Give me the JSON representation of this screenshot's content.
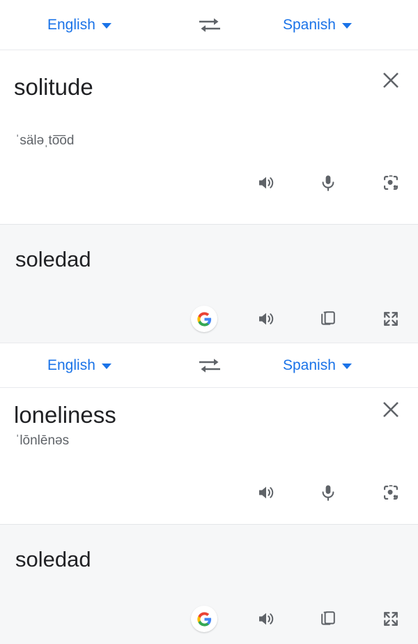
{
  "app": {
    "accent_blue": "#1a73e8",
    "icon_gray": "#5f6368",
    "text_dark": "#202124",
    "panel_gray": "#f6f7f8"
  },
  "cards": [
    {
      "language_bar": {
        "source_language": "English",
        "target_language": "Spanish",
        "swap_icon": "swap-horizontal-icon",
        "source_caret_icon": "chevron-down-icon",
        "target_caret_icon": "chevron-down-icon"
      },
      "source": {
        "word": "solitude",
        "phonetic": "ˈsäləˌto͞od",
        "clear_icon": "close-icon",
        "actions": [
          {
            "name": "listen-button",
            "icon": "speaker-icon"
          },
          {
            "name": "microphone-button",
            "icon": "microphone-icon"
          },
          {
            "name": "lens-button",
            "icon": "google-lens-icon"
          }
        ]
      },
      "result": {
        "word": "soledad",
        "actions": [
          {
            "name": "google-search-button",
            "icon": "google-g-icon"
          },
          {
            "name": "listen-result-button",
            "icon": "speaker-icon"
          },
          {
            "name": "copy-button",
            "icon": "copy-icon"
          },
          {
            "name": "fullscreen-button",
            "icon": "fullscreen-icon"
          }
        ]
      }
    },
    {
      "language_bar": {
        "source_language": "English",
        "target_language": "Spanish",
        "swap_icon": "swap-horizontal-icon",
        "source_caret_icon": "chevron-down-icon",
        "target_caret_icon": "chevron-down-icon"
      },
      "source": {
        "word": "loneliness",
        "phonetic": "ˈlōnlēnəs",
        "clear_icon": "close-icon",
        "actions": [
          {
            "name": "listen-button",
            "icon": "speaker-icon"
          },
          {
            "name": "microphone-button",
            "icon": "microphone-icon"
          },
          {
            "name": "lens-button",
            "icon": "google-lens-icon"
          }
        ]
      },
      "result": {
        "word": "soledad",
        "actions": [
          {
            "name": "google-search-button",
            "icon": "google-g-icon"
          },
          {
            "name": "listen-result-button",
            "icon": "speaker-icon"
          },
          {
            "name": "copy-button",
            "icon": "copy-icon"
          },
          {
            "name": "fullscreen-button",
            "icon": "fullscreen-icon"
          }
        ]
      }
    }
  ]
}
